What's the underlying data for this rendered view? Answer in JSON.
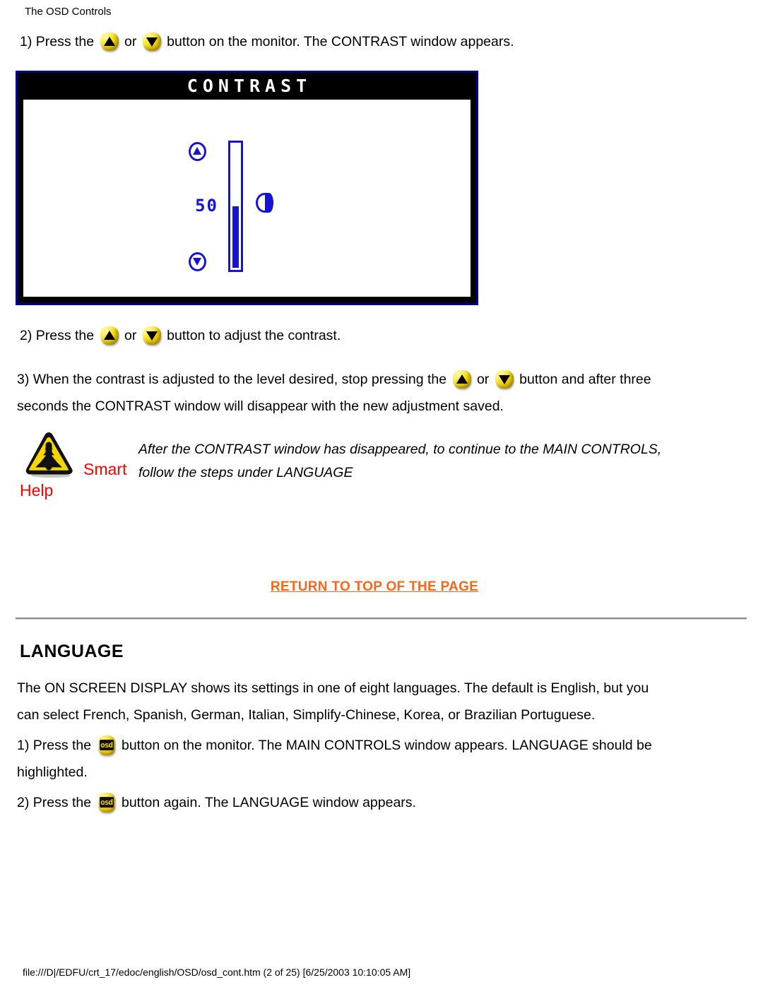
{
  "header": {
    "title": "The OSD Controls"
  },
  "contrast_steps": {
    "step1": {
      "pre": "1) Press the",
      "mid": "or",
      "post": "button on the monitor. The CONTRAST window appears."
    },
    "step2": {
      "pre": "2) Press the",
      "mid": "or",
      "post": "button to adjust the contrast."
    },
    "step3": {
      "pre": "3) When the contrast is adjusted to the level desired, stop pressing the",
      "mid": "or",
      "post": "button and after three",
      "line2": "seconds the CONTRAST window will disappear with the new adjustment saved."
    }
  },
  "osd_window": {
    "title": "CONTRAST",
    "value": "50",
    "value_percent": 50,
    "up_icon": "triangle-up-icon",
    "down_icon": "triangle-down-icon",
    "symbol_icon": "contrast-half-circle-icon",
    "border_color": "#000080",
    "accent_color": "#1414d2",
    "titlebar_color": "#000000"
  },
  "smart_help": {
    "icon": "warning-triangle-icon",
    "smart_label": "Smart",
    "help_label": "Help",
    "label_color": "#ff0000",
    "note_line1": "After the CONTRAST window has disappeared, to continue to the MAIN CONTROLS,",
    "note_line2": "follow the steps under LANGUAGE"
  },
  "return_link": {
    "label": "RETURN TO TOP OF THE PAGE",
    "color": "#f4681b"
  },
  "language_section": {
    "heading": "LANGUAGE",
    "intro_line1": "The ON SCREEN DISPLAY shows its settings in one of eight languages. The default is English, but you",
    "intro_line2": "can select French, Spanish, German, Italian, Simplify-Chinese, Korea, or Brazilian Portuguese.",
    "step1": {
      "pre": "1) Press the",
      "post": "button on the monitor. The MAIN CONTROLS window appears. LANGUAGE should be",
      "line2": "highlighted."
    },
    "step2": {
      "pre": "2) Press the",
      "post": "button again. The LANGUAGE window appears."
    },
    "osd_button_glyph": "osd"
  },
  "footer": {
    "text": "file:///D|/EDFU/crt_17/edoc/english/OSD/osd_cont.htm (2 of 25) [6/25/2003 10:10:05 AM]"
  }
}
